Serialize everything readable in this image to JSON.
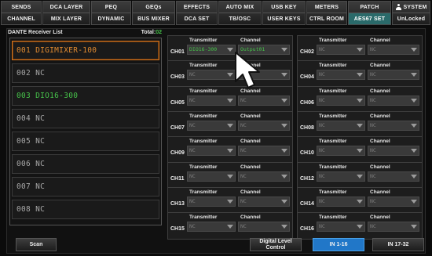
{
  "tabs": [
    {
      "top": "SENDS",
      "bottom": "CHANNEL"
    },
    {
      "top": "DCA LAYER",
      "bottom": "MIX LAYER"
    },
    {
      "top": "PEQ",
      "bottom": "DYNAMIC"
    },
    {
      "top": "GEQs",
      "bottom": "BUS MIXER"
    },
    {
      "top": "EFFECTS",
      "bottom": "DCA SET"
    },
    {
      "top": "AUTO MIX",
      "bottom": "TB/OSC"
    },
    {
      "top": "USB KEY",
      "bottom": "USER KEYS"
    },
    {
      "top": "METERS",
      "bottom": "CTRL ROOM"
    },
    {
      "top": "PATCH",
      "bottom": "AES67 SET",
      "active_bottom": true
    },
    {
      "top": "SYSTEM",
      "bottom": "UnLocked",
      "icon": "user-icon"
    }
  ],
  "receiver_list": {
    "title": "DANTE Receiver List",
    "total_label": "Total:",
    "total_value": "02",
    "items": [
      {
        "label": "001 DIGIMIXER-100",
        "state": "selected"
      },
      {
        "label": "002 NC",
        "state": "normal"
      },
      {
        "label": "003 DIO16-300",
        "state": "green"
      },
      {
        "label": "004 NC",
        "state": "normal"
      },
      {
        "label": "005 NC",
        "state": "normal"
      },
      {
        "label": "006 NC",
        "state": "normal"
      },
      {
        "label": "007 NC",
        "state": "normal"
      },
      {
        "label": "008 NC",
        "state": "normal"
      }
    ]
  },
  "channel_headers": {
    "transmitter": "Transmitter",
    "channel": "Channel"
  },
  "channels": [
    {
      "ch": "CH01",
      "tx": "DIO16-300",
      "chn": "Output01",
      "active": true
    },
    {
      "ch": "CH02",
      "tx": "NC",
      "chn": "NC"
    },
    {
      "ch": "CH03",
      "tx": "NC",
      "chn": "NC"
    },
    {
      "ch": "CH04",
      "tx": "NC",
      "chn": "NC"
    },
    {
      "ch": "CH05",
      "tx": "NC",
      "chn": "NC"
    },
    {
      "ch": "CH06",
      "tx": "NC",
      "chn": "NC"
    },
    {
      "ch": "CH07",
      "tx": "NC",
      "chn": "NC"
    },
    {
      "ch": "CH08",
      "tx": "NC",
      "chn": "NC"
    },
    {
      "ch": "CH09",
      "tx": "NC",
      "chn": "NC"
    },
    {
      "ch": "CH10",
      "tx": "NC",
      "chn": "NC"
    },
    {
      "ch": "CH11",
      "tx": "NC",
      "chn": "NC"
    },
    {
      "ch": "CH12",
      "tx": "NC",
      "chn": "NC"
    },
    {
      "ch": "CH13",
      "tx": "NC",
      "chn": "NC"
    },
    {
      "ch": "CH14",
      "tx": "NC",
      "chn": "NC"
    },
    {
      "ch": "CH15",
      "tx": "NC",
      "chn": "NC"
    },
    {
      "ch": "CH16",
      "tx": "NC",
      "chn": "NC"
    }
  ],
  "buttons": {
    "scan": "Scan",
    "digital_level_1": "Digital Level",
    "digital_level_2": "Control",
    "in_1_16": "IN 1-16",
    "in_17_32": "IN 17-32"
  },
  "colors": {
    "accent_green": "#46c24a",
    "selected_orange": "#d4741e",
    "active_blue": "#2177c8",
    "tab_active_teal": "#2a6a6a"
  }
}
